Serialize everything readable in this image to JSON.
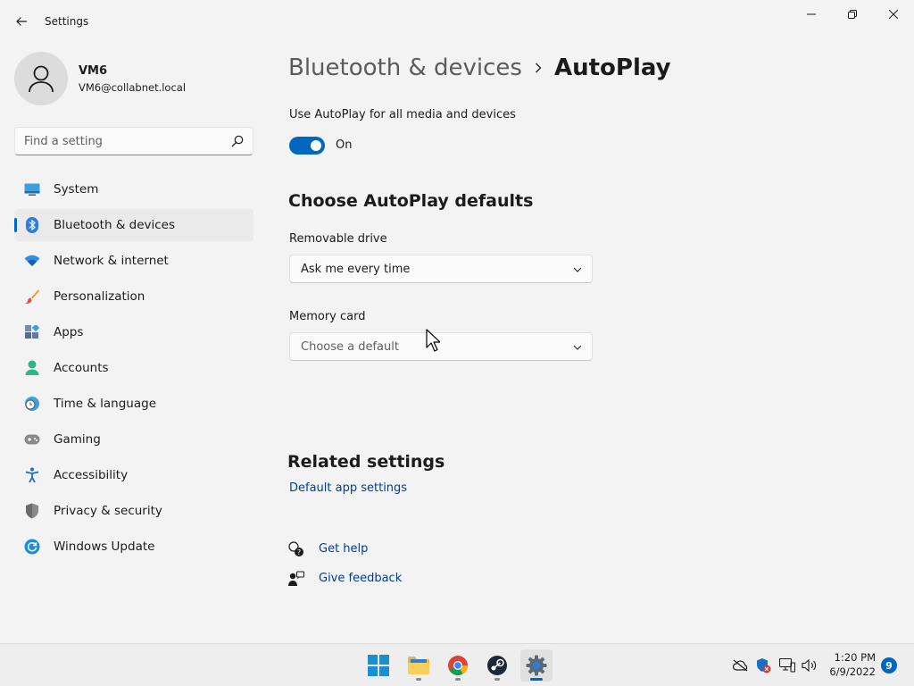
{
  "window": {
    "app_title": "Settings"
  },
  "profile": {
    "name": "VM6",
    "email": "VM6@collabnet.local"
  },
  "search": {
    "placeholder": "Find a setting"
  },
  "sidebar": {
    "items": [
      {
        "label": "System",
        "icon": "system-icon"
      },
      {
        "label": "Bluetooth & devices",
        "icon": "bluetooth-icon",
        "active": true
      },
      {
        "label": "Network & internet",
        "icon": "wifi-icon"
      },
      {
        "label": "Personalization",
        "icon": "brush-icon"
      },
      {
        "label": "Apps",
        "icon": "apps-icon"
      },
      {
        "label": "Accounts",
        "icon": "accounts-icon"
      },
      {
        "label": "Time & language",
        "icon": "clock-globe-icon"
      },
      {
        "label": "Gaming",
        "icon": "gamepad-icon"
      },
      {
        "label": "Accessibility",
        "icon": "accessibility-icon"
      },
      {
        "label": "Privacy & security",
        "icon": "shield-icon"
      },
      {
        "label": "Windows Update",
        "icon": "update-icon"
      }
    ]
  },
  "breadcrumb": {
    "parent": "Bluetooth & devices",
    "current": "AutoPlay"
  },
  "autoplay": {
    "toggle_label": "Use AutoPlay for all media and devices",
    "toggle_state": "On",
    "defaults_heading": "Choose AutoPlay defaults",
    "removable_label": "Removable drive",
    "removable_value": "Ask me every time",
    "memory_label": "Memory card",
    "memory_value": "Choose a default"
  },
  "related": {
    "heading": "Related settings",
    "default_app_link": "Default app settings"
  },
  "help": {
    "get_help": "Get help",
    "give_feedback": "Give feedback"
  },
  "taskbar": {
    "time": "1:20 PM",
    "date": "6/9/2022",
    "notification_count": "9"
  },
  "colors": {
    "accent": "#0067c0",
    "link": "#003e92",
    "background": "#f3f3f3"
  }
}
